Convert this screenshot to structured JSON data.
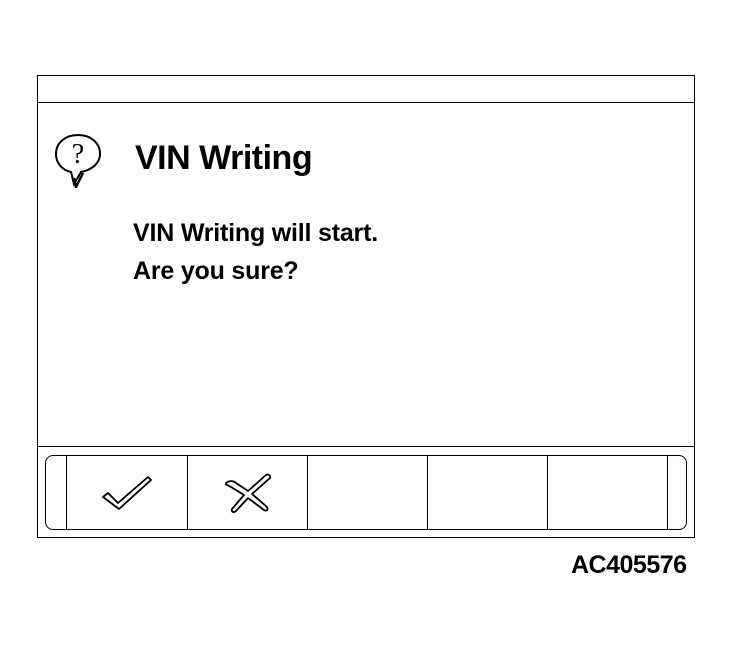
{
  "dialog": {
    "title": "VIN Writing",
    "icon": "question-bubble-icon",
    "message_lines": [
      "VIN Writing will start.",
      "Are you sure?"
    ]
  },
  "function_keys": [
    {
      "icon": "checkmark-icon",
      "label": ""
    },
    {
      "icon": "cross-icon",
      "label": ""
    },
    {
      "icon": "",
      "label": ""
    },
    {
      "icon": "",
      "label": ""
    },
    {
      "icon": "",
      "label": ""
    }
  ],
  "figure_code": "AC405576"
}
